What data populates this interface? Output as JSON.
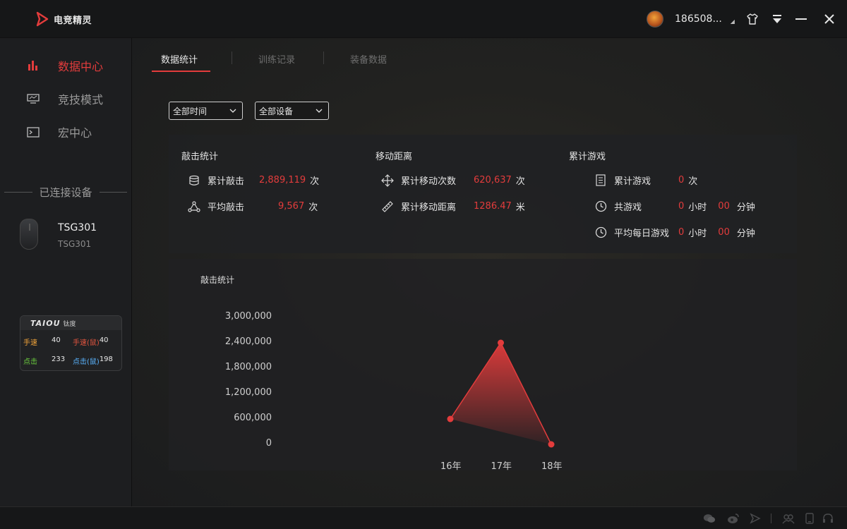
{
  "app": {
    "logo_text": "电竞精灵",
    "username": "186508...",
    "accent": "#e33c3c"
  },
  "titlebar": {
    "icons": [
      "skin-icon",
      "download-icon",
      "minimize-icon",
      "close-icon"
    ]
  },
  "sidebar": {
    "items": [
      {
        "label": "数据中心",
        "icon": "bar-chart-icon",
        "active": true
      },
      {
        "label": "竞技模式",
        "icon": "monitor-icon",
        "active": false
      },
      {
        "label": "宏中心",
        "icon": "terminal-icon",
        "active": false
      }
    ],
    "connected_title": "已连接设备",
    "device": {
      "name": "TSG301",
      "model": "TSG301"
    },
    "taiou": {
      "logo": "TAIOU",
      "brand_cn": "钛度",
      "hand_speed_label": "手速",
      "hand_speed": "40",
      "hand_speed_mouse_label": "手速(鼠)",
      "hand_speed_mouse": "40",
      "click_label": "点击",
      "click": "233",
      "click_mouse_label": "点击(鼠)",
      "click_mouse": "198"
    }
  },
  "tabs": [
    {
      "label": "数据统计",
      "active": true
    },
    {
      "label": "训练记录",
      "active": false
    },
    {
      "label": "装备数据",
      "active": false
    }
  ],
  "filters": {
    "time": "全部时间",
    "device": "全部设备"
  },
  "stats": {
    "clicks": {
      "title": "敲击统计",
      "total_label": "累计敲击",
      "total_value": "2,889,119",
      "total_unit": "次",
      "avg_label": "平均敲击",
      "avg_value": "9,567",
      "avg_unit": "次"
    },
    "movement": {
      "title": "移动距离",
      "count_label": "累计移动次数",
      "count_value": "620,637",
      "count_unit": "次",
      "distance_label": "累计移动距离",
      "distance_value": "1286.47",
      "distance_unit": "米"
    },
    "games": {
      "title": "累计游戏",
      "total_label": "累计游戏",
      "total_value": "0",
      "total_unit": "次",
      "time_label": "共游戏",
      "time_hours": "0",
      "time_hours_unit": "小时",
      "time_minutes": "00",
      "time_minutes_unit": "分钟",
      "daily_label": "平均每日游戏",
      "daily_hours": "0",
      "daily_hours_unit": "小时",
      "daily_minutes": "00",
      "daily_minutes_unit": "分钟"
    }
  },
  "chart_data": {
    "type": "area",
    "title": "敲击统计",
    "categories": [
      "16年",
      "17年",
      "18年"
    ],
    "values": [
      600000,
      2400000,
      0
    ],
    "yticks": [
      "3,000,000",
      "2,400,000",
      "1,800,000",
      "1,200,000",
      "600,000",
      "0"
    ],
    "ylim": [
      0,
      3000000
    ],
    "color": "#e33c3c"
  }
}
